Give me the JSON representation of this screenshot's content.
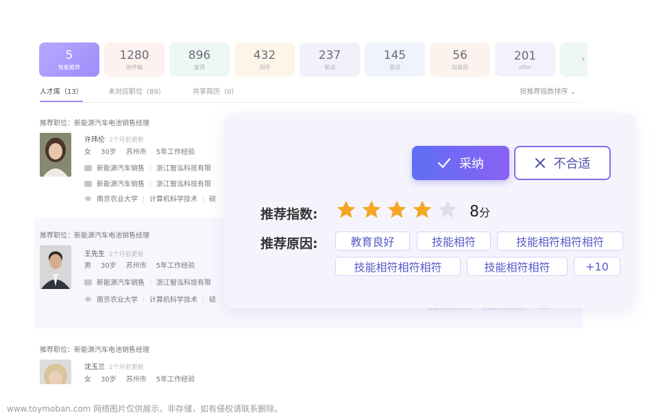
{
  "stats": [
    {
      "num": "5",
      "label": "智能推荐"
    },
    {
      "num": "1280",
      "label": "收件箱"
    },
    {
      "num": "896",
      "label": "复筛"
    },
    {
      "num": "432",
      "label": "测评"
    },
    {
      "num": "237",
      "label": "笔试"
    },
    {
      "num": "145",
      "label": "面试"
    },
    {
      "num": "56",
      "label": "拟录用"
    },
    {
      "num": "201",
      "label": "offer"
    }
  ],
  "stats_more_icon": "chevron-right-icon",
  "tabs": [
    {
      "label": "人才库（13）"
    },
    {
      "label": "未对应职位（89）"
    },
    {
      "label": "共享简历（0）"
    }
  ],
  "sort_label": "按推荐指数排序",
  "candidates": [
    {
      "rec": "推荐职位：新能源汽车电池销售经理",
      "name": "许玮伦",
      "updated": "2个月前更新",
      "gender": "女",
      "age": "30岁",
      "city": "苏州市",
      "exp": "5年工作经验",
      "jobs": [
        {
          "title": "新能源汽车销售",
          "company": "浙江智泓科技有限"
        },
        {
          "title": "新能源汽车销售",
          "company": "浙江智泓科技有限"
        }
      ],
      "edu": {
        "school": "南京农业大学",
        "major": "计算机科学技术",
        "degree": "硕"
      }
    },
    {
      "rec": "推荐职位：新能源汽车电池销售经理",
      "name": "王先生",
      "updated": "2个月前更新",
      "gender": "男",
      "age": "30岁",
      "city": "苏州市",
      "exp": "5年工作经验",
      "jobs": [
        {
          "title": "新能源汽车销售",
          "company": "浙江智泓科技有限"
        }
      ],
      "edu": {
        "school": "南京农业大学",
        "major": "计算机科学技术",
        "degree": "硕"
      },
      "tags_faded": [
        "技能相符相符相符",
        "技能相符相符相符",
        "+10"
      ]
    },
    {
      "rec": "推荐职位：新能源汽车电池销售经理",
      "name": "沈玉兰",
      "updated": "2个月前更新",
      "gender": "女",
      "age": "30岁",
      "city": "苏州市",
      "exp": "5年工作经验"
    }
  ],
  "panel": {
    "accept_label": "采纳",
    "reject_label": "不合适",
    "index_label": "推荐指数:",
    "rating": 4,
    "rating_max": 5,
    "score": "8",
    "score_unit": "分",
    "reason_label": "推荐原因:",
    "reasons": [
      "教育良好",
      "技能相符",
      "技能相符相符相符",
      "技能相符相符相符",
      "技能相符相符",
      "+10"
    ]
  },
  "colors": {
    "accent": "#8a62f3",
    "accent_start": "#5e6ff5",
    "star_on": "#f5a623",
    "star_off": "#e0dfe8",
    "tag_text": "#5559c8"
  },
  "watermark": "www.toymoban.com 网络图片仅供展示，非存储，如有侵权请联系删除。"
}
